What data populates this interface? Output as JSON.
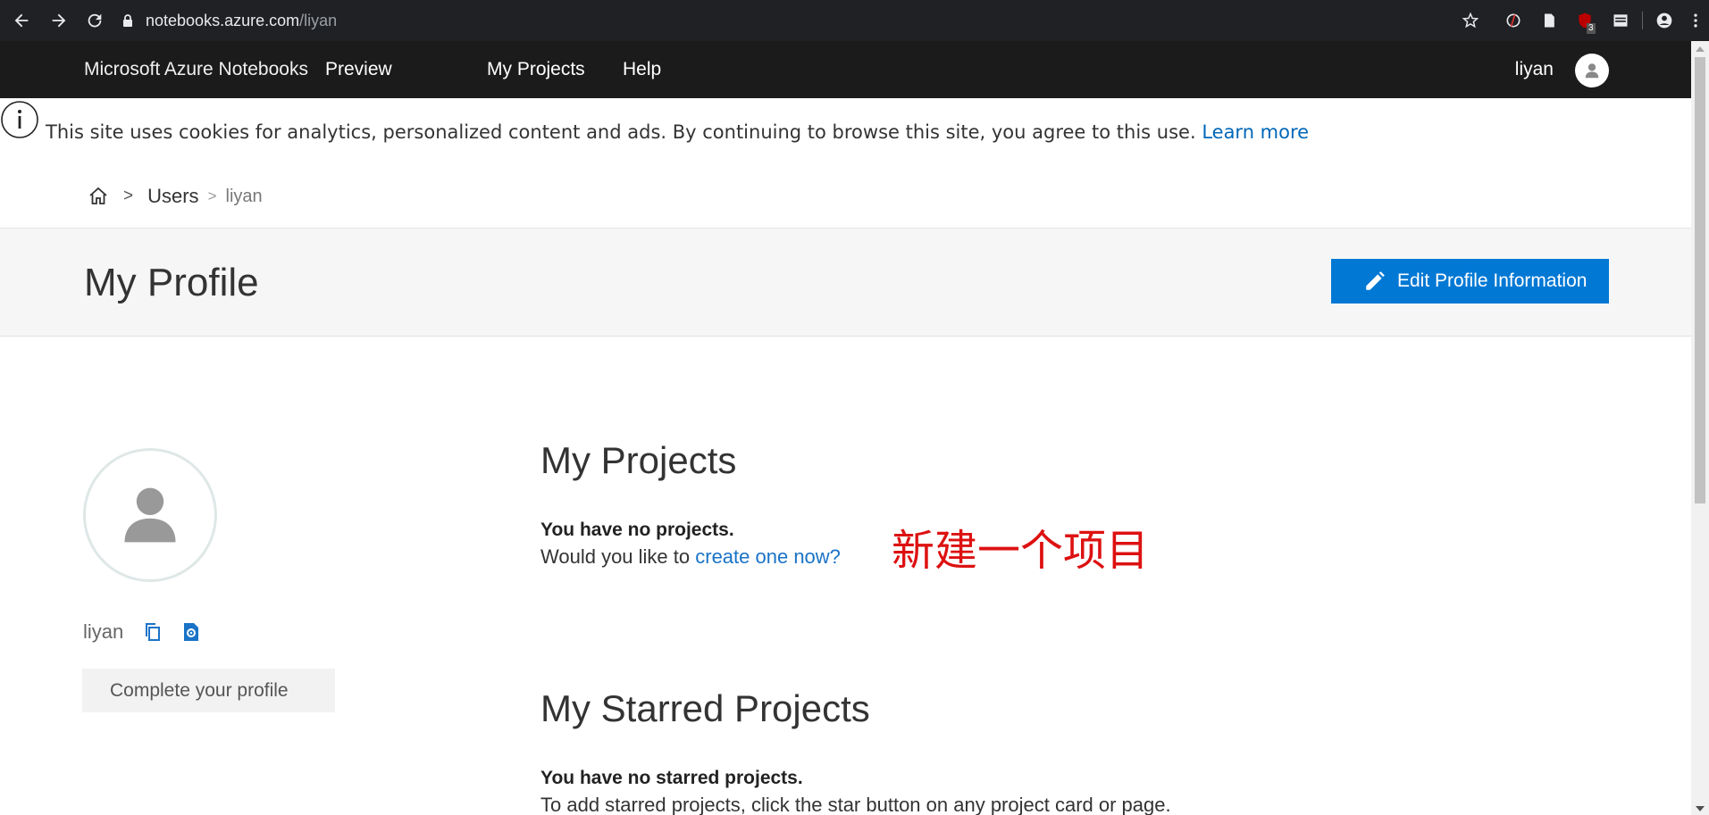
{
  "browser": {
    "url_host": "notebooks.azure.com",
    "url_path": "/liyan",
    "extension_badge": "3"
  },
  "nav": {
    "brand": "Microsoft Azure Notebooks",
    "preview": "Preview",
    "links": [
      "My Projects",
      "Help"
    ],
    "user": "liyan"
  },
  "cookie": {
    "text": "This site uses cookies for analytics, personalized content and ads. By continuing to browse this site, you agree to this use.",
    "link": "Learn more"
  },
  "breadcrumb": {
    "sep1": ">",
    "users": "Users",
    "sep2": ">",
    "current": "liyan"
  },
  "profile": {
    "title": "My Profile",
    "edit_button": "Edit Profile Information",
    "username": "liyan",
    "complete_button": "Complete your profile"
  },
  "projects": {
    "title": "My Projects",
    "empty_bold": "You have no projects.",
    "prompt_prefix": "Would you like to ",
    "prompt_link": "create one now?"
  },
  "annotation": "新建一个项目",
  "starred": {
    "title": "My Starred Projects",
    "empty_bold": "You have no starred projects.",
    "hint": "To add starred projects, click the star button on any project card or page."
  },
  "colors": {
    "accent": "#0078d4",
    "link": "#0067b8",
    "annotation": "#dd1111",
    "nav_bg": "#1b1b1b"
  }
}
